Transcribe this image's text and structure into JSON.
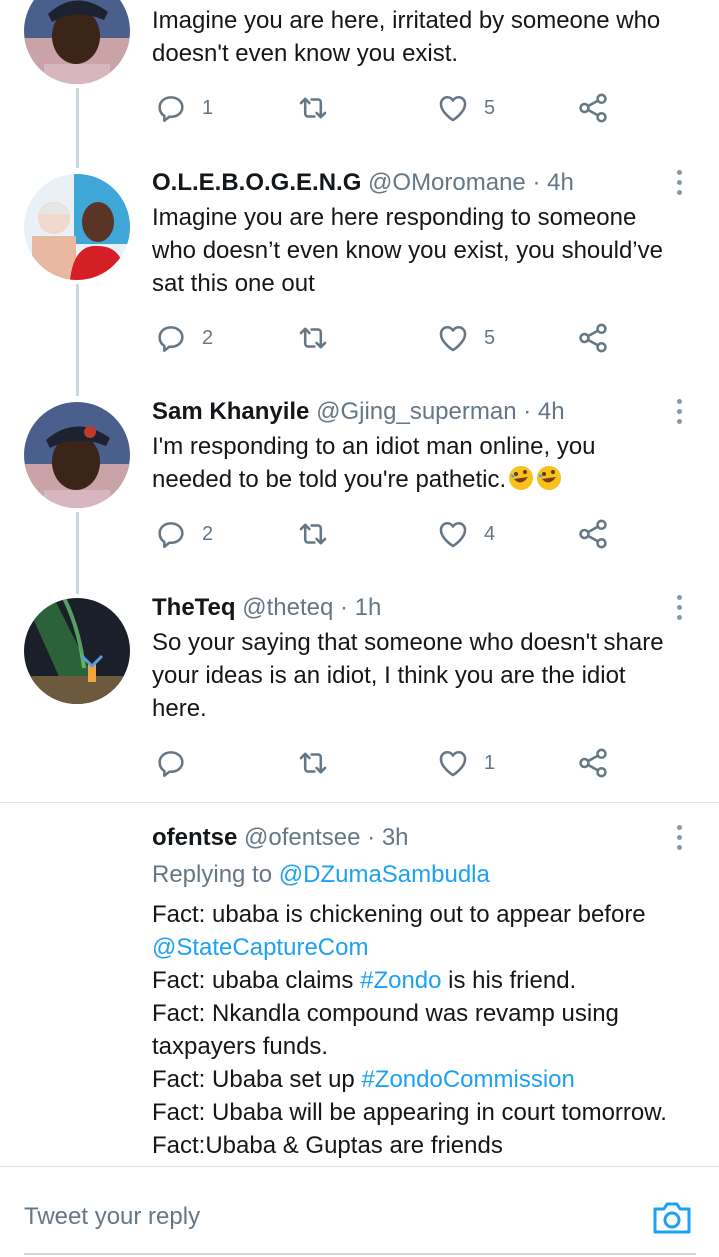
{
  "colors": {
    "accent": "#1da1f2",
    "muted": "#657786",
    "text": "#14171a",
    "thread": "#ccd6dd"
  },
  "tweets": [
    {
      "text": "Imagine you are here, irritated by someone who\ndoesn't even know you exist.",
      "replies": "1",
      "retweets": "",
      "likes": "5"
    },
    {
      "name": "O.L.E.B.O.G.E.N.G",
      "handle": "@OMoromane",
      "time": "4h",
      "text": "Imagine you are here responding to someone\nwho doesn’t even know you exist, you should’ve\nsat this one out",
      "replies": "2",
      "retweets": "",
      "likes": "5"
    },
    {
      "name": "Sam Khanyile",
      "handle": "@Gjing_superman",
      "time": "4h",
      "text": "I'm responding to an idiot man online, you\nneeded to be told you're pathetic.",
      "emoji": "rolling-on-floor-laughing-icon",
      "replies": "2",
      "retweets": "",
      "likes": "4"
    },
    {
      "name": "TheTeq",
      "handle": "@theteq",
      "time": "1h",
      "text": "So your saying that someone who doesn't share\nyour ideas is an idiot, I think you are the idiot\nhere.",
      "replies": "",
      "retweets": "",
      "likes": "1"
    }
  ],
  "reply_tweet": {
    "name": "ofentse",
    "handle": "@ofentsee",
    "time": "3h",
    "replying_prefix": "Replying to",
    "replying_to": "@DZumaSambudla",
    "lines": {
      "l1": "Fact: ubaba is chickening out to appear before",
      "l2_link": "@StateCaptureCom",
      "l3_pre": "Fact: ubaba claims ",
      "l3_tag": "#Zondo",
      "l3_post": " is his friend.",
      "l4": "Fact: Nkandla compound was revamp using",
      "l5": "taxpayers funds.",
      "l6_pre": "Fact: Ubaba set up ",
      "l6_tag": "#ZondoCommission",
      "l7": "Fact: Ubaba will be appearing in court tomorrow.",
      "l8": "Fact:Ubaba & Guptas are friends"
    }
  },
  "composer": {
    "placeholder": "Tweet your reply",
    "icon": "camera-icon"
  },
  "separator": "·"
}
